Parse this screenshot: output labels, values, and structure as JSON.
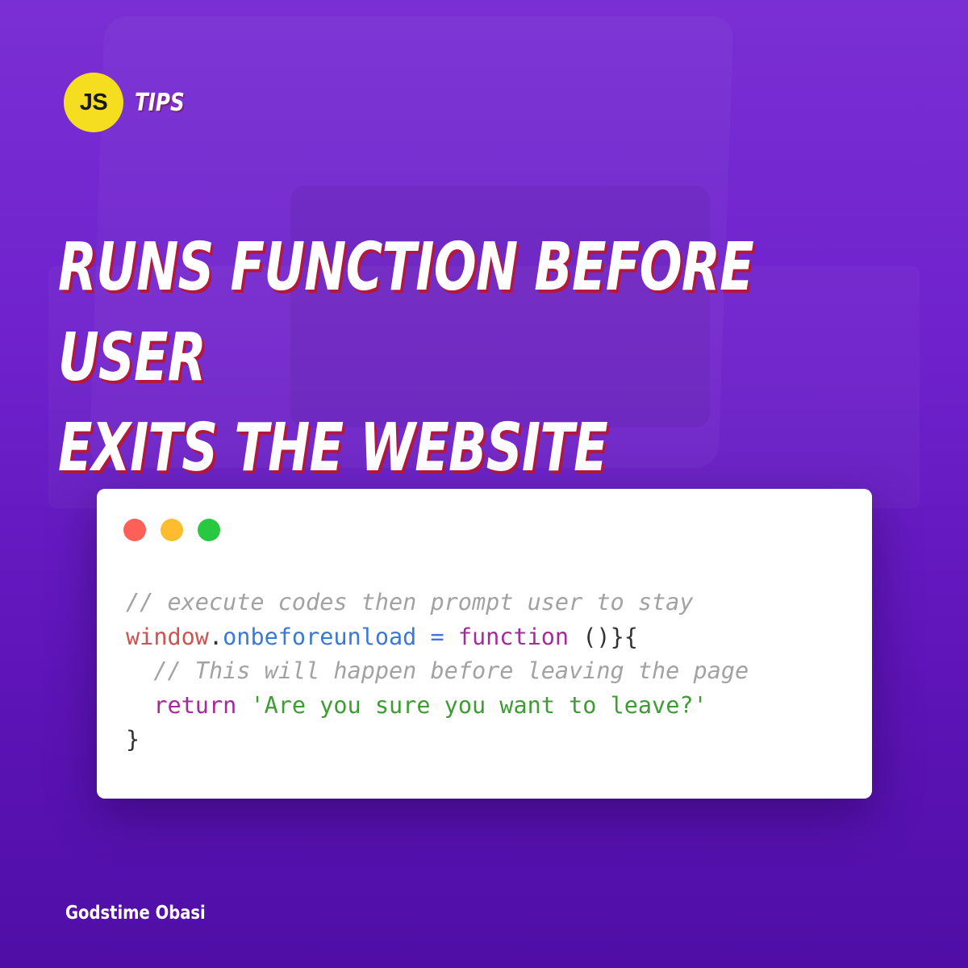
{
  "logo": {
    "badge_text": "JS",
    "label": "TIPS",
    "badge_color": "#f4de1f"
  },
  "headline": {
    "line1": "RUNS FUNCTION BEFORE USER",
    "line2": "EXITS THE WEBSITE"
  },
  "code_window": {
    "window_controls": [
      "close",
      "minimize",
      "maximize"
    ],
    "lines": [
      {
        "tokens": [
          {
            "text": "// execute codes then prompt user to stay",
            "kind": "comment"
          }
        ]
      },
      {
        "tokens": [
          {
            "text": "window",
            "kind": "var"
          },
          {
            "text": ".",
            "kind": "punct"
          },
          {
            "text": "onbeforeunload",
            "kind": "prop"
          },
          {
            "text": " = ",
            "kind": "prop"
          },
          {
            "text": "function",
            "kind": "kw"
          },
          {
            "text": " ()}{",
            "kind": "punct"
          }
        ]
      },
      {
        "tokens": [
          {
            "text": "  // This will happen before leaving the page",
            "kind": "comment"
          }
        ]
      },
      {
        "tokens": [
          {
            "text": "  ",
            "kind": "punct"
          },
          {
            "text": "return",
            "kind": "kw"
          },
          {
            "text": " ",
            "kind": "punct"
          },
          {
            "text": "'Are you sure you want to leave?'",
            "kind": "str"
          }
        ]
      },
      {
        "tokens": [
          {
            "text": "}",
            "kind": "punct"
          }
        ]
      }
    ]
  },
  "author": "Godstime Obasi",
  "colors": {
    "background_top": "#7a2fd4",
    "background_bottom": "#4f0ea6",
    "headline_shadow": "#b3183e",
    "dot_red": "#fe5f57",
    "dot_yellow": "#febc2e",
    "dot_green": "#28c840"
  }
}
